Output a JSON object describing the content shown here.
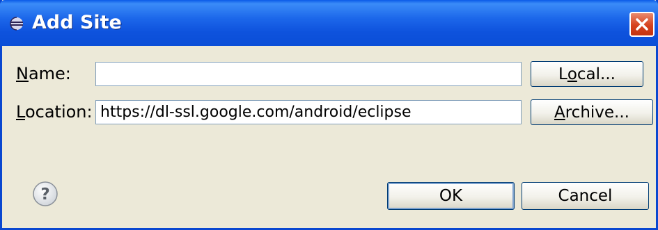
{
  "window": {
    "title": "Add Site",
    "title_icon": "eclipse-icon",
    "close_icon": "close-icon"
  },
  "form": {
    "name": {
      "label_mnemonic": "N",
      "label_rest": "ame:",
      "value": ""
    },
    "location": {
      "label_mnemonic": "L",
      "label_rest": "ocation:",
      "value": "https://dl-ssl.google.com/android/eclipse"
    }
  },
  "buttons": {
    "local": {
      "pre": "L",
      "mnemonic": "o",
      "post": "cal..."
    },
    "archive": {
      "pre": "",
      "mnemonic": "A",
      "post": "rchive..."
    },
    "ok": "OK",
    "cancel": "Cancel"
  },
  "help": {
    "icon": "help-icon",
    "glyph": "?"
  },
  "colors": {
    "titlebar": "#0b4fd7",
    "dialog_bg": "#ece9d8",
    "close": "#d6421e"
  }
}
